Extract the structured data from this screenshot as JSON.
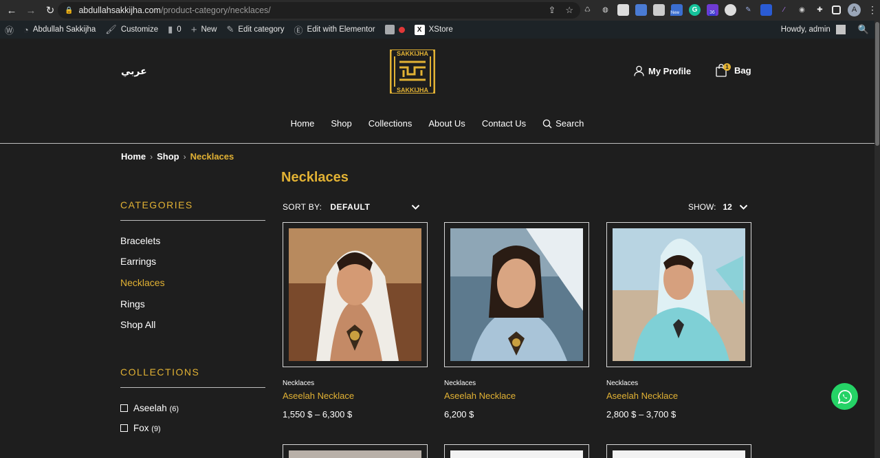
{
  "browser": {
    "url_host": "abdullahsakkijha.com",
    "url_path": "/product-category/necklaces/",
    "profile_initial": "A",
    "ext_badges": [
      "New",
      "36"
    ]
  },
  "admin_bar": {
    "site_name": "Abdullah Sakkijha",
    "customize": "Customize",
    "comments_count": "0",
    "new": "New",
    "edit_category": "Edit category",
    "edit_elementor": "Edit with Elementor",
    "xstore": "XStore",
    "howdy": "Howdy, admin"
  },
  "header": {
    "language_link": "عربي",
    "logo_top": "SAKKIJHA",
    "logo_bottom": "SAKKIJHA",
    "my_profile": "My Profile",
    "bag": "Bag",
    "bag_count": "1",
    "nav": [
      "Home",
      "Shop",
      "Collections",
      "About Us",
      "Contact Us",
      "Search"
    ]
  },
  "breadcrumb": [
    "Home",
    "Shop",
    "Necklaces"
  ],
  "sidebar": {
    "categories_title": "CATEGORIES",
    "categories": [
      "Bracelets",
      "Earrings",
      "Necklaces",
      "Rings",
      "Shop All"
    ],
    "active_category": "Necklaces",
    "collections_title": "COLLECTIONS",
    "collections": [
      {
        "name": "Aseelah",
        "count": "(6)"
      },
      {
        "name": "Fox",
        "count": "(9)"
      }
    ]
  },
  "main": {
    "title": "Necklaces",
    "sort_label": "SORT BY:",
    "sort_value": "DEFAULT",
    "show_label": "SHOW:",
    "show_value": "12",
    "products": [
      {
        "category": "Necklaces",
        "name": "Aseelah Necklace",
        "price": "1,550 $ – 6,300 $"
      },
      {
        "category": "Necklaces",
        "name": "Aseelah Necklace",
        "price": "6,200 $"
      },
      {
        "category": "Necklaces",
        "name": "Aseelah Necklace",
        "price": "2,800 $ – 3,700 $"
      }
    ]
  },
  "colors": {
    "accent": "#e2b234",
    "background": "#1e1e1e",
    "whatsapp": "#25d366"
  }
}
